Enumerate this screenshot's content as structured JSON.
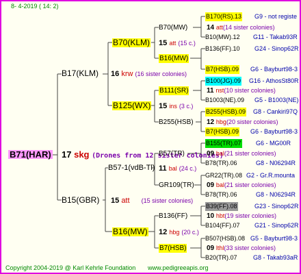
{
  "header": {
    "date": "8-  4-2019  ( 14:   2)"
  },
  "footer": {
    "copyright": "Copyright 2004-2019 @ Karl Kehrle Foundation",
    "site": "www.pedigreeapis.org"
  },
  "colors": {
    "frame": "#e000e0",
    "yellow": "#ffff00",
    "cyan": "#00ffff",
    "green": "#00dd00",
    "gray": "#999999",
    "queen_highlight": "#ff99ff",
    "drone_text": "#7a00aa",
    "info_blue": "#0000aa",
    "red": "#cc0000"
  },
  "root": {
    "name": "B71(HAR)",
    "num": "17",
    "code": "skg",
    "drones": "(Drones from 12 sister colonies)"
  },
  "gen1": [
    {
      "name": "B17(KLM)",
      "num": "16",
      "code": "krw",
      "colonies": "(16 sister colonies)"
    },
    {
      "name": "B15(GBR)",
      "num": "15",
      "code": "att",
      "colonies": "(15 sister colonies)"
    }
  ],
  "gen2": [
    {
      "name": "B70(KLM)",
      "num": "15",
      "code": "att",
      "colonies": "(15 c.)"
    },
    {
      "name": "B125(WX)",
      "num": "15",
      "code": "ins",
      "colonies": "(3 c.)"
    },
    {
      "name": "B57-1(vdB-Tl)",
      "num": "11",
      "code": "bal",
      "colonies": "(24 c.)"
    },
    {
      "name": "B16(MW)",
      "num": "12",
      "code": "hbg",
      "colonies": "(20 c.)"
    }
  ],
  "gen3": [
    {
      "name": "B70(MW)",
      "num": "14",
      "code": "att",
      "colonies": "(14 sister colonies)"
    },
    {
      "name": "B16(MW)"
    },
    {
      "name": "B111(SR)",
      "num": "11",
      "code": "nst",
      "colonies": "(10 sister colonies)"
    },
    {
      "name": "B255(HSB)",
      "num": "12",
      "code": "hbg",
      "colonies": "(20 sister colonies)"
    },
    {
      "name": "B57(TR)",
      "num": "09",
      "code": "bal",
      "colonies": "(21 sister colonies)"
    },
    {
      "name": "GR109(TR)",
      "num": "09",
      "code": "bal",
      "colonies": "(21 sister colonies)"
    },
    {
      "name": "B136(FF)",
      "num": "10",
      "code": "hbt",
      "colonies": "(19 sister colonies)"
    },
    {
      "name": "B7(HSB)",
      "num": "09",
      "code": "lthl",
      "colonies": "(33 sister colonies)"
    }
  ],
  "gen4": [
    {
      "name": "B170(RS).13",
      "info": "G9 - not registe"
    },
    {
      "name": "B10(MW).12",
      "info": "G11 - Takab93R"
    },
    {
      "name": "B136(FF).10",
      "info": "G24 - Sinop62R"
    },
    {
      "name": "B7(HSB).09",
      "info": "G6 - Bayburt98-3"
    },
    {
      "name": "B100(JG).09",
      "info": "G16 - AthosSt80R"
    },
    {
      "name": "B1003(NE).09",
      "info": "G5 - B1003(NE)"
    },
    {
      "name": "B255(HSB).09",
      "info": "G8 - Cankiri97Q"
    },
    {
      "name": "B7(HSB).09",
      "info": "G6 - Bayburt98-3"
    },
    {
      "name": "B155(TR).07",
      "info": "G6 - MG00R"
    },
    {
      "name": "B78(TR).06",
      "info": "G8 - N06294R"
    },
    {
      "name": "GR22(TR).08",
      "info": "G2 - Gr.R.mounta"
    },
    {
      "name": "B78(TR).06",
      "info": "G8 - N06294R"
    },
    {
      "name": "B39(FF).08",
      "info": "G23 - Sinop62R"
    },
    {
      "name": "B104(FF).07",
      "info": "G21 - Sinop62R"
    },
    {
      "name": "B507(HSB).08",
      "info": "G5 - Bayburt98-3"
    },
    {
      "name": "B20(TR).07",
      "info": "G8 - Takab93aR"
    }
  ]
}
